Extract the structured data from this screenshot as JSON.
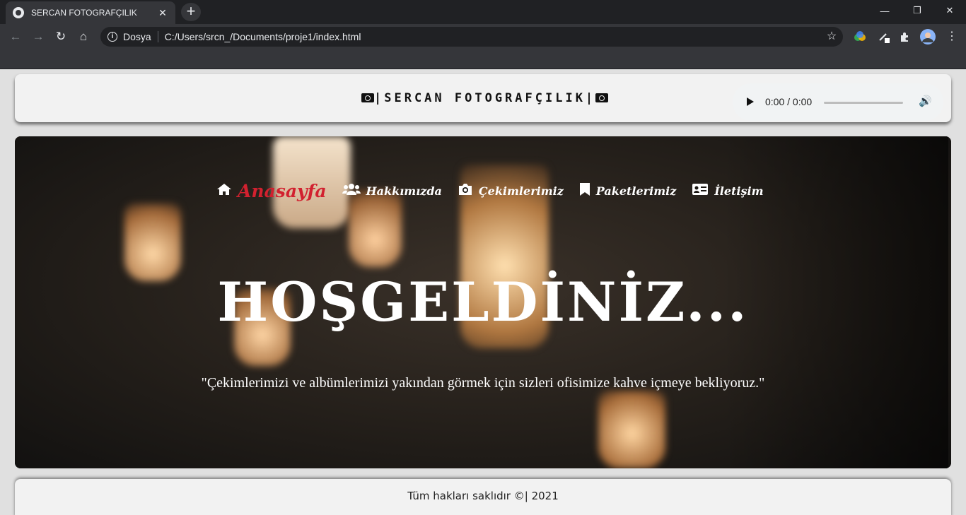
{
  "browser": {
    "tab_title": "SERCAN FOTOGRAFÇILIK",
    "tab_close": "✕",
    "new_tab": "+",
    "window": {
      "minimize": "—",
      "maximize": "❐",
      "close": "✕"
    },
    "nav": {
      "back": "←",
      "forward": "→",
      "reload": "↻",
      "home": "⌂"
    },
    "scheme_label": "Dosya",
    "url": "C:/Users/srcn_/Documents/proje1/index.html",
    "toolbar_icons": [
      "star-icon",
      "color-picker-icon",
      "pen-icon",
      "extensions-icon",
      "profile-avatar",
      "menu-icon"
    ]
  },
  "header": {
    "brand": "|SERCAN FOTOGRAFÇILIK|",
    "audio": {
      "time": "0:00 / 0:00",
      "progress": 0
    }
  },
  "hero": {
    "nav": [
      {
        "label": "Anasayfa",
        "icon": "home-icon",
        "active": true
      },
      {
        "label": "Hakkımızda",
        "icon": "users-icon",
        "active": false
      },
      {
        "label": "Çekimlerimiz",
        "icon": "camera-icon",
        "active": false
      },
      {
        "label": "Paketlerimiz",
        "icon": "bookmark-icon",
        "active": false
      },
      {
        "label": "İletişim",
        "icon": "id-card-icon",
        "active": false
      }
    ],
    "welcome": "HOŞGELDİNİZ...",
    "quote": "\"Çekimlerimizi ve albümlerimizi yakından görmek için sizleri ofisimize kahve içmeye bekliyoruz.\""
  },
  "footer": {
    "text": "Tüm hakları saklıdır ©| 2021"
  },
  "colors": {
    "active_nav": "#d2212f",
    "panel_bg": "#f2f2f2",
    "page_bg": "#e0e0e0"
  }
}
